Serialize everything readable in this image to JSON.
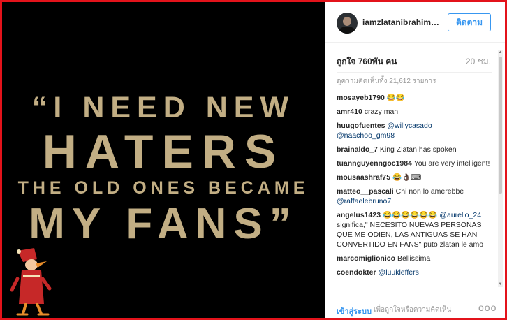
{
  "post_image": {
    "quote_line1": "“I NEED NEW",
    "quote_line2": "HATERS",
    "quote_line3": "THE OLD ONES BECAME",
    "quote_line4": "MY FANS”"
  },
  "header": {
    "username": "iamzlatanibrahimovic",
    "follow_label": "ติดตาม"
  },
  "stats": {
    "likes": "ถูกใจ 760พัน คน",
    "time": "20 ชม."
  },
  "comments": {
    "view_all": "ดูความคิดเห็นทั้ง 21,612 รายการ",
    "items": [
      {
        "user": "mosayeb1790",
        "text": "😂😂"
      },
      {
        "user": "amr410",
        "text": "crazy man"
      },
      {
        "user": "huugofuentes",
        "mention": "@willycasado",
        "mention2": "@naachoo_gm98"
      },
      {
        "user": "brainaldo_7",
        "text": "King Zlatan has spoken"
      },
      {
        "user": "tuannguyenngoc1984",
        "text": "You are very intelligent!"
      },
      {
        "user": "mousaashraf75",
        "text": "😂👌🏿⌨"
      },
      {
        "user": "matteo__pascali",
        "text": "Chi non lo amerebbe",
        "mention": "@raffaelebruno7"
      },
      {
        "user": "angelus1423",
        "text": "😂😂😂😂😂😂",
        "mention": "@aurelio_24",
        "text2": "significa,\" NECESITO NUEVAS PERSONAS QUE ME ODIEN, LAS ANTIGUAS SE HAN CONVERTIDO EN FANS\" puto zlatan le amo"
      },
      {
        "user": "marcomiglionico",
        "text": "Bellissima"
      },
      {
        "user": "coendokter",
        "mention": "@luukleffers"
      }
    ]
  },
  "footer": {
    "login_label": "เข้าสู่ระบบ",
    "prompt": "เพื่อถูกใจหรือความคิดเห็น",
    "more": "ooo"
  },
  "colors": {
    "frame": "#e3131b",
    "quote_gold": "#c2ae84",
    "accent": "#3897f0",
    "mention": "#003569"
  }
}
